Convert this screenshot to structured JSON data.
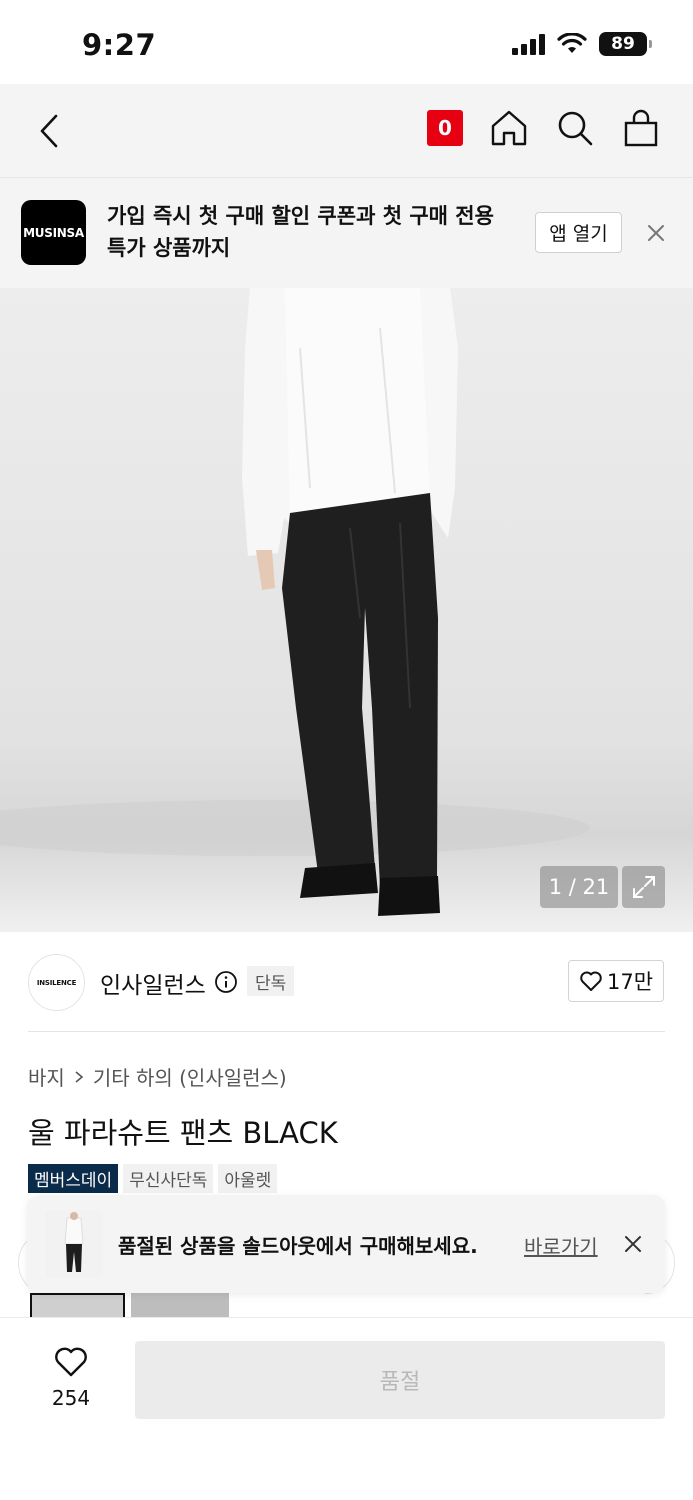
{
  "status_bar": {
    "time": "9:27",
    "battery": "89"
  },
  "nav": {
    "cart_count": "0"
  },
  "app_banner": {
    "logo_text": "MUSINSA",
    "message": "가입 즉시 첫 구매 할인 쿠폰과 첫 구매 전용 특가 상품까지",
    "open_app_label": "앱 열기"
  },
  "gallery": {
    "counter": "1 / 21"
  },
  "brand": {
    "logo_text": "INSILENCE",
    "name": "인사일런스",
    "exclusive_tag": "단독",
    "like_count": "17만"
  },
  "breadcrumb": {
    "category": "바지",
    "subcategory": "기타 하의 (인사일런스)"
  },
  "product": {
    "title": "울 파라슈트 팬츠 BLACK",
    "tags": [
      "멤버스데이",
      "무신사단독",
      "아울렛"
    ]
  },
  "toast": {
    "message": "품절된 상품을 솔드아웃에서 구매해보세요.",
    "link_label": "바로가기"
  },
  "bottom_bar": {
    "like_count": "254",
    "buy_button_label": "품절"
  },
  "colors": {
    "accent_red": "#e60012",
    "member_tag": "#0b2b4a",
    "banner_bg": "#f4f4f4",
    "disabled_button": "#ebebeb"
  }
}
